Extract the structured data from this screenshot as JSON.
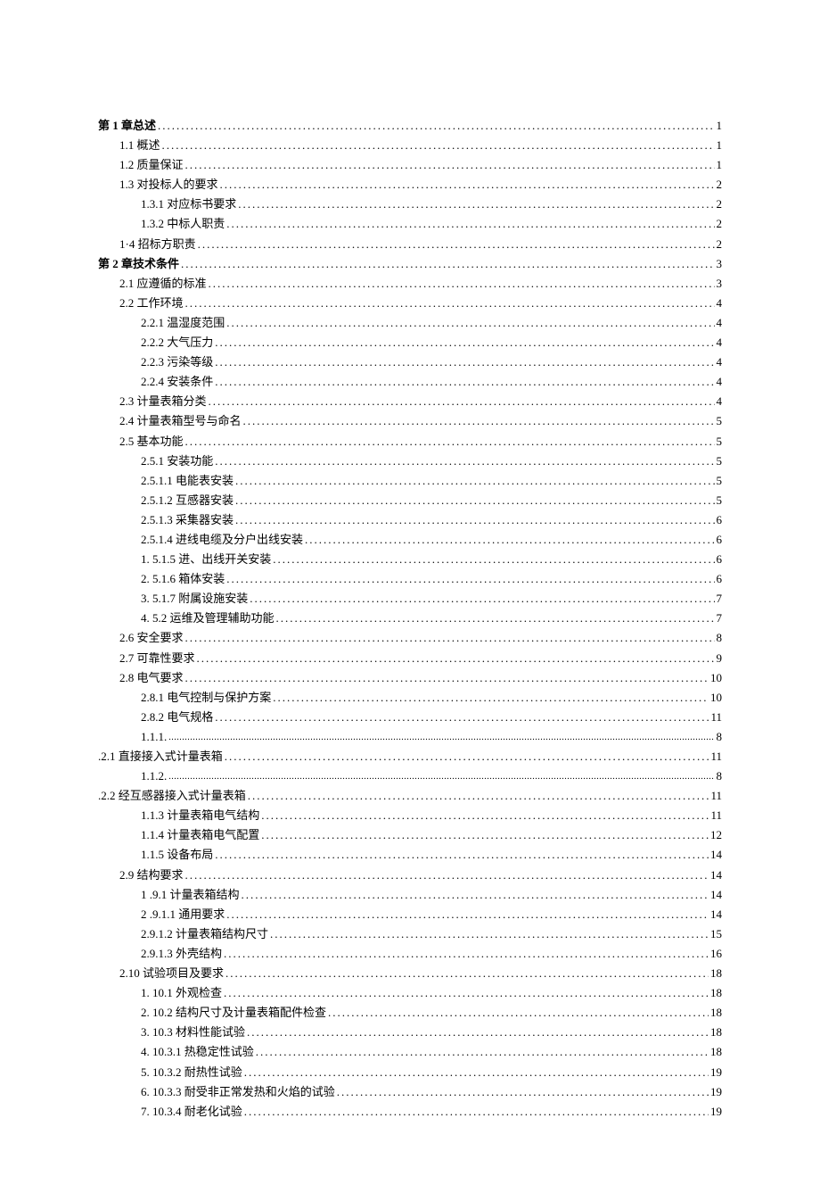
{
  "toc": [
    {
      "label": "第 1 章总述",
      "page": "1",
      "indent": 0,
      "bold": true,
      "fine": false
    },
    {
      "label": "1.1   概述",
      "page": "1",
      "indent": 1,
      "bold": false,
      "fine": false
    },
    {
      "label": "1.2   质量保证",
      "page": "1",
      "indent": 1,
      "bold": false,
      "fine": false
    },
    {
      "label": "1.3   对投标人的要求",
      "page": "2",
      "indent": 1,
      "bold": false,
      "fine": false
    },
    {
      "label": "1.3.1  对应标书要求",
      "page": "2",
      "indent": 2,
      "bold": false,
      "fine": false
    },
    {
      "label": "1.3.2  中标人职责",
      "page": "2",
      "indent": 2,
      "bold": false,
      "fine": false
    },
    {
      "label": "1·4 招标方职责",
      "page": "2",
      "indent": 1,
      "bold": false,
      "fine": false
    },
    {
      "label": "第 2 章技术条件",
      "page": "3",
      "indent": 0,
      "bold": true,
      "fine": false
    },
    {
      "label": "2.1    应遵循的标准",
      "page": "3",
      "indent": 1,
      "bold": false,
      "fine": false
    },
    {
      "label": "2.2   工作环境",
      "page": "4",
      "indent": 1,
      "bold": false,
      "fine": false
    },
    {
      "label": "2.2.1    温湿度范围",
      "page": "4",
      "indent": 2,
      "bold": false,
      "fine": false
    },
    {
      "label": "2.2.2    大气压力",
      "page": "4",
      "indent": 2,
      "bold": false,
      "fine": false
    },
    {
      "label": "2.2.3    污染等级",
      "page": "4",
      "indent": 2,
      "bold": false,
      "fine": false
    },
    {
      "label": "2.2.4    安装条件",
      "page": "4",
      "indent": 2,
      "bold": false,
      "fine": false
    },
    {
      "label": "2.3   计量表箱分类",
      "page": "4",
      "indent": 1,
      "bold": false,
      "fine": false
    },
    {
      "label": "2.4   计量表箱型号与命名",
      "page": "5",
      "indent": 1,
      "bold": false,
      "fine": false
    },
    {
      "label": "2.5   基本功能",
      "page": "5",
      "indent": 1,
      "bold": false,
      "fine": false
    },
    {
      "label": "2.5.1  安装功能",
      "page": "5",
      "indent": 2,
      "bold": false,
      "fine": false
    },
    {
      "label": "2.5.1.1 电能表安装",
      "page": "5",
      "indent": 2,
      "bold": false,
      "fine": false
    },
    {
      "label": "2.5.1.2 互感器安装",
      "page": "5",
      "indent": 2,
      "bold": false,
      "fine": false
    },
    {
      "label": "2.5.1.3 采集器安装",
      "page": "6",
      "indent": 2,
      "bold": false,
      "fine": false
    },
    {
      "label": "2.5.1.4 进线电缆及分户出线安装",
      "page": "6",
      "indent": 2,
      "bold": false,
      "fine": false
    },
    {
      "label": "1.    5.1.5 进、出线开关安装",
      "page": "6",
      "indent": 2,
      "bold": false,
      "fine": false
    },
    {
      "label": "2.    5.1.6 箱体安装",
      "page": "6",
      "indent": 2,
      "bold": false,
      "fine": false
    },
    {
      "label": "3.    5.1.7 附属设施安装",
      "page": "7",
      "indent": 2,
      "bold": false,
      "fine": false
    },
    {
      "label": "4.    5.2 运维及管理辅助功能",
      "page": "7",
      "indent": 2,
      "bold": false,
      "fine": false
    },
    {
      "label": "2.6   安全要求",
      "page": "8",
      "indent": 1,
      "bold": false,
      "fine": false
    },
    {
      "label": "2.7   可靠性要求",
      "page": "9",
      "indent": 1,
      "bold": false,
      "fine": false
    },
    {
      "label": "2.8   电气要求",
      "page": "10",
      "indent": 1,
      "bold": false,
      "fine": false
    },
    {
      "label": "2.8.1   电气控制与保护方案",
      "page": "10",
      "indent": 2,
      "bold": false,
      "fine": false
    },
    {
      "label": "2.8.2   电气规格",
      "page": "11",
      "indent": 2,
      "bold": false,
      "fine": false
    },
    {
      "label": "1.1.1.",
      "page": "8",
      "indent": 2,
      "bold": false,
      "fine": true
    },
    {
      "label": ".2.1 直接接入式计量表箱",
      "page": "11",
      "indent": -1,
      "bold": false,
      "fine": false
    },
    {
      "label": "1.1.2.",
      "page": "8",
      "indent": 2,
      "bold": false,
      "fine": true
    },
    {
      "label": ".2.2 经互感器接入式计量表箱",
      "page": "11",
      "indent": -1,
      "bold": false,
      "fine": false
    },
    {
      "label": "1.1.3   计量表箱电气结构",
      "page": "11",
      "indent": 2,
      "bold": false,
      "fine": false
    },
    {
      "label": "1.1.4   计量表箱电气配置",
      "page": "12",
      "indent": 2,
      "bold": false,
      "fine": false
    },
    {
      "label": "1.1.5   设备布局",
      "page": "14",
      "indent": 2,
      "bold": false,
      "fine": false
    },
    {
      "label": "2.9 结构要求",
      "page": "14",
      "indent": 1,
      "bold": false,
      "fine": false
    },
    {
      "label": "1    .9.1 计量表箱结构",
      "page": "14",
      "indent": 2,
      "bold": false,
      "fine": false
    },
    {
      "label": "2   .9.1.1 通用要求",
      "page": "14",
      "indent": 2,
      "bold": false,
      "fine": false
    },
    {
      "label": "2.9.1.2 计量表箱结构尺寸",
      "page": "15",
      "indent": 2,
      "bold": false,
      "fine": false
    },
    {
      "label": "2.9.1.3 外壳结构",
      "page": "16",
      "indent": 2,
      "bold": false,
      "fine": false
    },
    {
      "label": "2.10 试验项目及要求",
      "page": "18",
      "indent": 1,
      "bold": false,
      "fine": false
    },
    {
      "label": "1.    10.1 外观检查",
      "page": "18",
      "indent": 2,
      "bold": false,
      "fine": false
    },
    {
      "label": "2.    10.2 结构尺寸及计量表箱配件检查",
      "page": "18",
      "indent": 2,
      "bold": false,
      "fine": false
    },
    {
      "label": "3.    10.3 材料性能试验",
      "page": "18",
      "indent": 2,
      "bold": false,
      "fine": false
    },
    {
      "label": "4.    10.3.1 热稳定性试验",
      "page": "18",
      "indent": 2,
      "bold": false,
      "fine": false
    },
    {
      "label": "5.    10.3.2 耐热性试验",
      "page": "19",
      "indent": 2,
      "bold": false,
      "fine": false
    },
    {
      "label": "6.    10.3.3 耐受非正常发热和火焰的试验",
      "page": "19",
      "indent": 2,
      "bold": false,
      "fine": false
    },
    {
      "label": "7.    10.3.4 耐老化试验",
      "page": "19",
      "indent": 2,
      "bold": false,
      "fine": false
    }
  ]
}
